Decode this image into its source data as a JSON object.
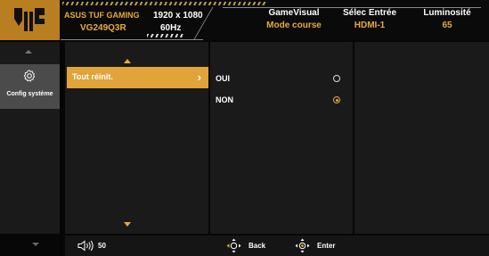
{
  "header": {
    "model_top": "ASUS TUF GAMING",
    "model_bottom": "VG249Q3R",
    "resolution": "1920 x 1080",
    "refresh": "60Hz",
    "gamevisual_label": "GameVisual",
    "gamevisual_value": "Mode course",
    "input_label": "Sélec Entrée",
    "input_value": "HDMI-1",
    "brightness_label": "Luminosité",
    "brightness_value": "65"
  },
  "sidebar": {
    "selected_label": "Config système",
    "selected_icon": "gear-icon"
  },
  "menu": {
    "selected_item": "Tout réinit.",
    "chevron": "›"
  },
  "options": [
    {
      "label": "OUI",
      "checked": false
    },
    {
      "label": "NON",
      "checked": true
    }
  ],
  "bottom": {
    "volume_value": "50",
    "back_label": "Back",
    "enter_label": "Enter"
  },
  "colors": {
    "accent": "#e0a43a",
    "logo_bg": "#b87e20",
    "panel_bg": "#1a1a1a",
    "selected_bg": "#4b4b4b"
  }
}
